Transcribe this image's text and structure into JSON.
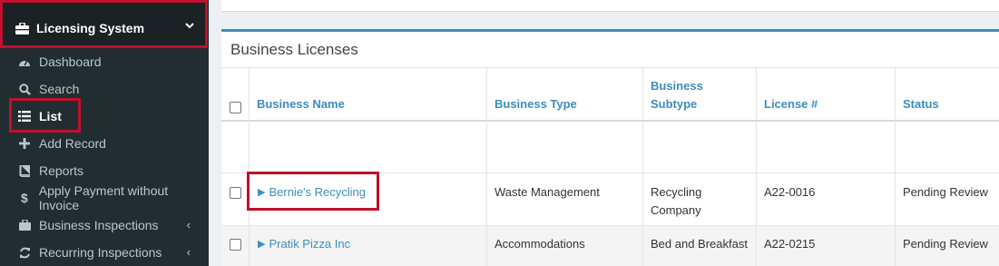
{
  "sidebar": {
    "header_label": "Licensing System",
    "items": [
      {
        "label": "Dashboard",
        "icon": "tachometer-icon"
      },
      {
        "label": "Search",
        "icon": "search-icon"
      },
      {
        "label": "List",
        "icon": "list-icon"
      },
      {
        "label": "Add Record",
        "icon": "plus-icon"
      },
      {
        "label": "Reports",
        "icon": "book-icon"
      },
      {
        "label": "Apply Payment without Invoice",
        "icon": "dollar-icon"
      },
      {
        "label": "Business Inspections",
        "icon": "building-icon"
      },
      {
        "label": "Recurring Inspections",
        "icon": "refresh-icon"
      }
    ]
  },
  "panel": {
    "title": "Business Licenses",
    "columns": {
      "business_name": "Business Name",
      "business_type": "Business Type",
      "business_subtype_line1": "Business",
      "business_subtype_line2": "Subtype",
      "license_no": "License #",
      "status": "Status"
    },
    "rows": [
      {
        "name": "Bernie's Recycling",
        "type": "Waste Management",
        "subtype_line1": "Recycling",
        "subtype_line2": "Company",
        "license": "A22-0016",
        "status": "Pending Review"
      },
      {
        "name": "Pratik Pizza Inc",
        "type": "Accommodations",
        "subtype": "Bed and Breakfast",
        "license": "A22-0215",
        "status": "Pending Review"
      }
    ]
  },
  "colors": {
    "sidebar_bg": "#222d32",
    "accent": "#3c8dbc",
    "highlight": "#c0102b"
  }
}
